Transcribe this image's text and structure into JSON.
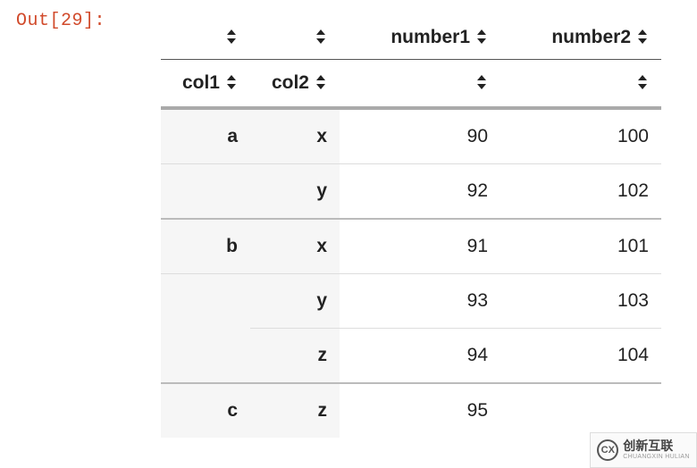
{
  "prompt": "Out[29]:",
  "headers_top": {
    "blank1": "",
    "blank2": "",
    "number1": "number1",
    "number2": "number2"
  },
  "headers_sub": {
    "col1": "col1",
    "col2": "col2",
    "blank1": "",
    "blank2": ""
  },
  "rows": [
    {
      "idx1": "a",
      "idx2": "x",
      "n1": "90",
      "n2": "100",
      "show_idx1": true,
      "group_last": false
    },
    {
      "idx1": "",
      "idx2": "y",
      "n1": "92",
      "n2": "102",
      "show_idx1": false,
      "group_last": true
    },
    {
      "idx1": "b",
      "idx2": "x",
      "n1": "91",
      "n2": "101",
      "show_idx1": true,
      "group_last": false
    },
    {
      "idx1": "",
      "idx2": "y",
      "n1": "93",
      "n2": "103",
      "show_idx1": false,
      "group_last": false
    },
    {
      "idx1": "",
      "idx2": "z",
      "n1": "94",
      "n2": "104",
      "show_idx1": false,
      "group_last": true
    },
    {
      "idx1": "c",
      "idx2": "z",
      "n1": "95",
      "n2": "",
      "show_idx1": true,
      "group_last": false
    }
  ],
  "watermark": {
    "logo_text": "CX",
    "cn": "创新互联",
    "en": "CHUANGXIN HULIAN"
  }
}
